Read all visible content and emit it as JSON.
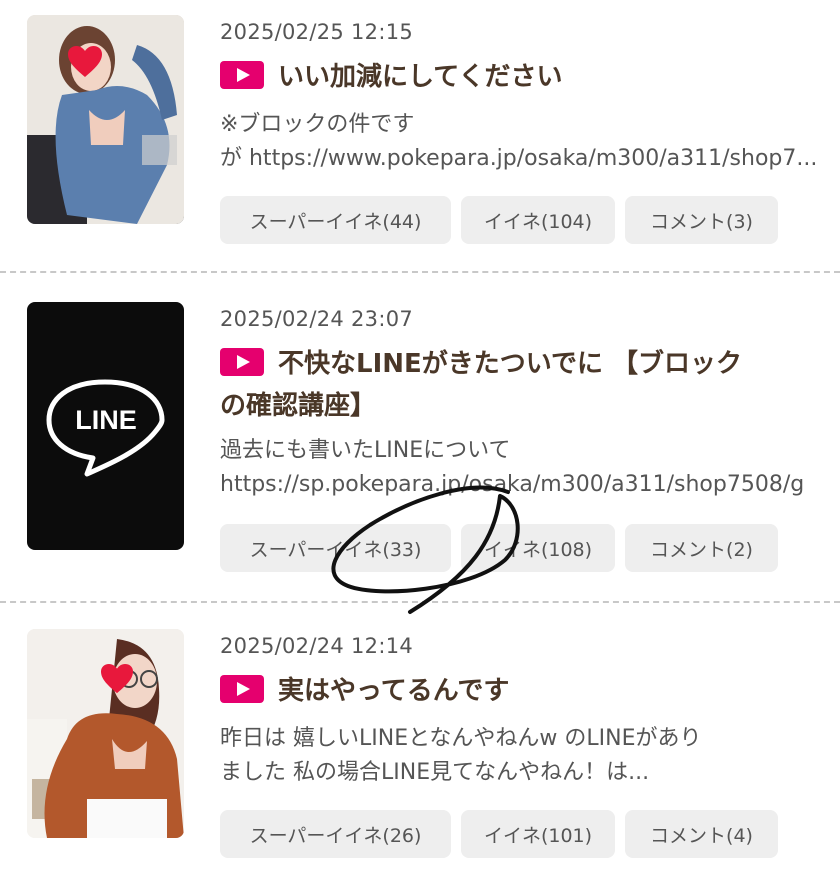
{
  "posts": [
    {
      "date": "2025/02/25 12:15",
      "title_lines": [
        "いい加減にしてください"
      ],
      "excerpt_lines": [
        "※ブロックの件です",
        "が https://www.pokepara.jp/osaka/m300/a311/shop7..."
      ],
      "buttons": [
        "スーパーイイネ(44)",
        "イイネ(104)",
        "コメント(3)"
      ]
    },
    {
      "date": "2025/02/24 23:07",
      "title_lines": [
        "不快なLINEがきたついでに 【ブロック",
        "の確認講座】"
      ],
      "thumb_logo": "LINE",
      "excerpt_lines": [
        "過去にも書いたLINEについて",
        "https://sp.pokepara.jp/osaka/m300/a311/shop7508/g"
      ],
      "buttons": [
        "スーパーイイネ(33)",
        "イイネ(108)",
        "コメント(2)"
      ]
    },
    {
      "date": "2025/02/24 12:14",
      "title_lines": [
        "実はやってるんです"
      ],
      "excerpt_lines": [
        "昨日は 嬉しいLINEとなんやねんw のLINEがあり",
        "ました 私の場合LINE見てなんやねん！は..."
      ],
      "buttons": [
        "スーパーイイネ(26)",
        "イイネ(101)",
        "コメント(4)"
      ]
    }
  ],
  "colors": {
    "accent": "#e5006e",
    "title": "#4a3728",
    "button_bg": "#eeeeee",
    "separator": "#c8c8c8"
  },
  "icons": {
    "play": "play-icon",
    "heart": "heart-icon",
    "line_logo": "line-logo-icon"
  }
}
